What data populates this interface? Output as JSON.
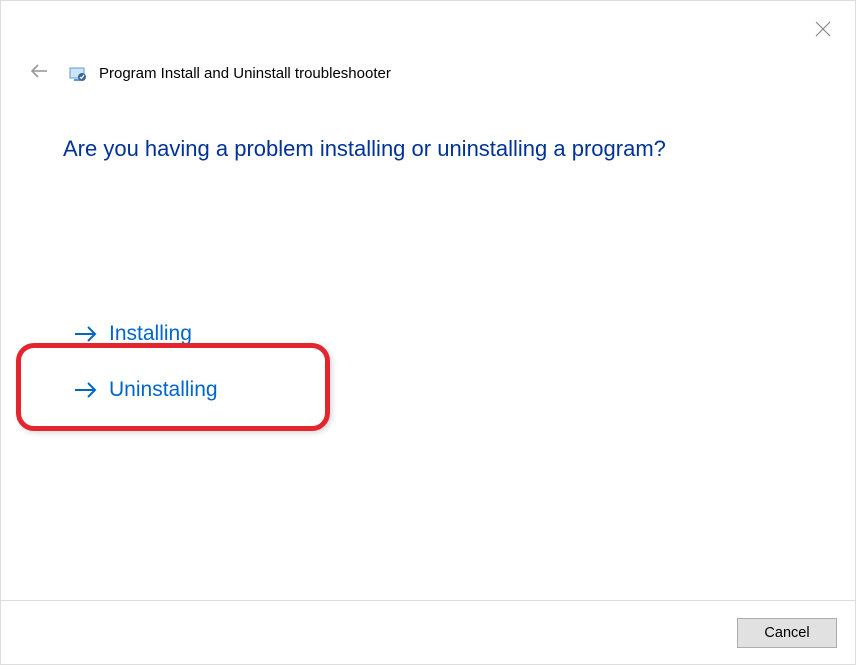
{
  "window": {
    "title": "Program Install and Uninstall troubleshooter"
  },
  "main": {
    "question": "Are you having a problem installing or uninstalling a program?",
    "options": {
      "installing": "Installing",
      "uninstalling": "Uninstalling"
    }
  },
  "footer": {
    "cancel_label": "Cancel"
  }
}
